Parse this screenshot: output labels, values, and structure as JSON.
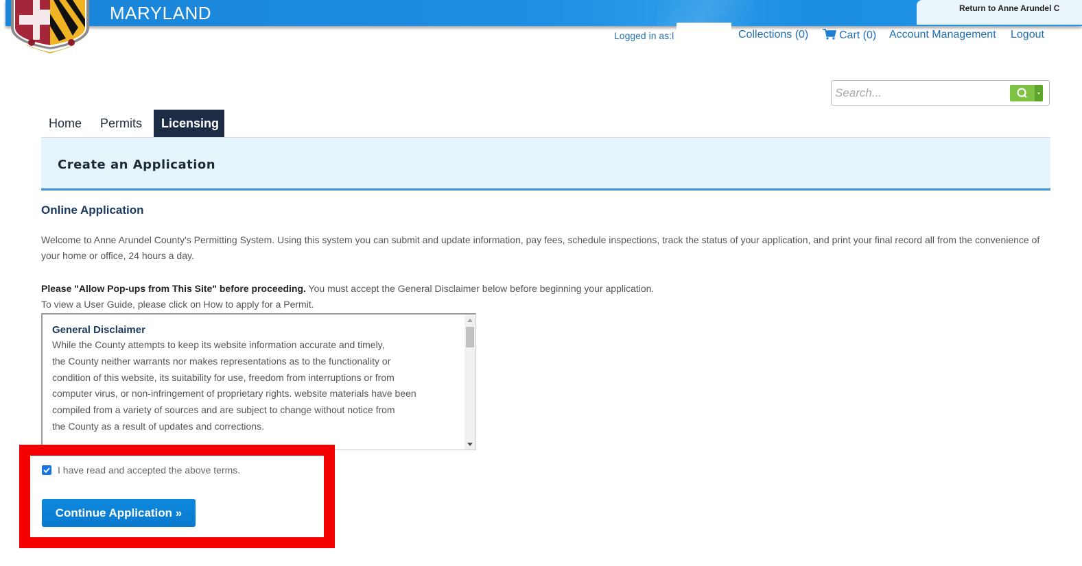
{
  "header": {
    "brand": "MARYLAND",
    "return_link": "Return to Anne Arundel C",
    "colors": {
      "bar": "#1e8fe2",
      "accent_nav": "#1d2c45",
      "button": "#0d88dc",
      "highlight": "#f50000",
      "search_green": "#7dc242"
    }
  },
  "user_nav": {
    "logged_in_label": "Logged in as:l",
    "collections": "Collections (0)",
    "cart": "Cart (0)",
    "account": "Account Management",
    "logout": "Logout"
  },
  "search": {
    "placeholder": "Search..."
  },
  "tabs": [
    {
      "label": "Home",
      "active": false
    },
    {
      "label": "Permits",
      "active": false
    },
    {
      "label": "Licensing",
      "active": true
    }
  ],
  "page_title": "Create an Application",
  "section_title": "Online Application",
  "intro": "Welcome to Anne Arundel County's Permitting System. Using this system you can submit and update information, pay fees, schedule inspections, track the status of your application, and print your final record all from the convenience of your home or office, 24 hours a day.",
  "popup_notice": {
    "bold": "Please \"Allow Pop-ups from This Site\" before proceeding.",
    "rest": " You must accept the General Disclaimer below before beginning your application.",
    "guide": "To view a User Guide, please click on How to apply for a Permit."
  },
  "disclaimer": {
    "title": "General Disclaimer",
    "lines": [
      "While the County attempts to keep its website information accurate and timely,",
      "the County neither warrants nor makes representations as to the functionality or",
      "condition of this website, its suitability for use, freedom from interruptions or from",
      "computer virus, or non-infringement of proprietary rights. website materials have been",
      "compiled from a variety of sources and are subject to change without notice from",
      "the County as a result of updates and corrections."
    ]
  },
  "accept": {
    "label": "I have read and accepted the above terms.",
    "checked": true
  },
  "continue_button": "Continue Application »"
}
